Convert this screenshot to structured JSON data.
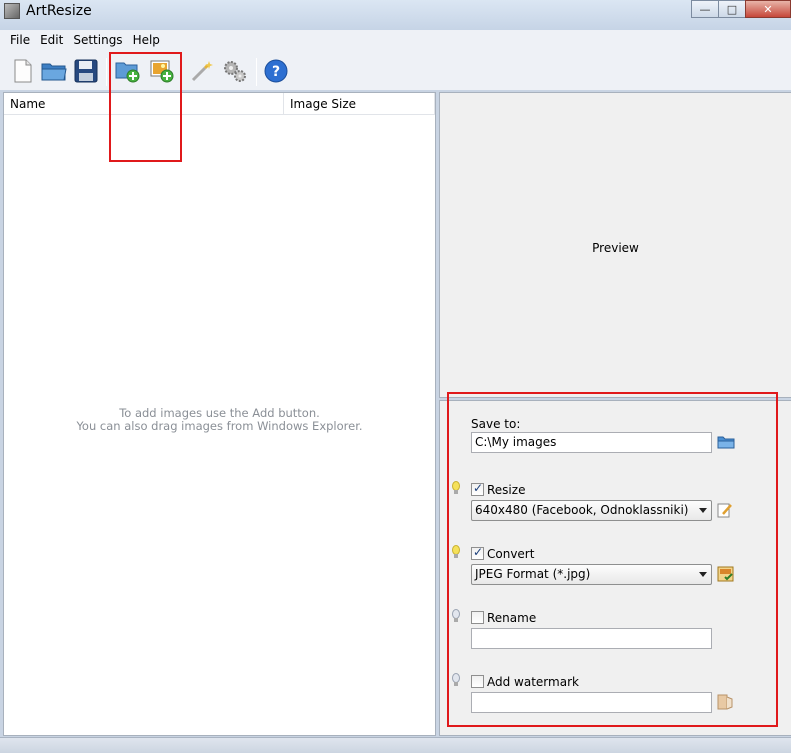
{
  "window": {
    "title": "ArtResize",
    "minimize": "—",
    "maximize": "□",
    "close": "✕"
  },
  "menu": [
    "File",
    "Edit",
    "Settings",
    "Help"
  ],
  "toolbar": {
    "buttons": [
      "new-document",
      "open-folder",
      "save",
      "add-folder",
      "add-images",
      "magic-wand",
      "settings-gears",
      "help"
    ]
  },
  "list": {
    "columns": [
      "Name",
      "Image Size"
    ],
    "empty_line1": "To add images use the Add button.",
    "empty_line2": "You can also drag images from Windows Explorer."
  },
  "preview": {
    "label": "Preview"
  },
  "settings": {
    "save_to_label": "Save to:",
    "save_to_value": "C:\\My images",
    "resize_label": "Resize",
    "resize_checked": true,
    "resize_value": "640x480 (Facebook, Odnoklassniki)",
    "convert_label": "Convert",
    "convert_checked": true,
    "convert_value": "JPEG Format (*.jpg)",
    "rename_label": "Rename",
    "rename_checked": false,
    "rename_value": "",
    "watermark_label": "Add watermark",
    "watermark_checked": false,
    "watermark_value": ""
  },
  "colors": {
    "highlight": "#e0191b",
    "help_blue": "#2d6fd1"
  }
}
